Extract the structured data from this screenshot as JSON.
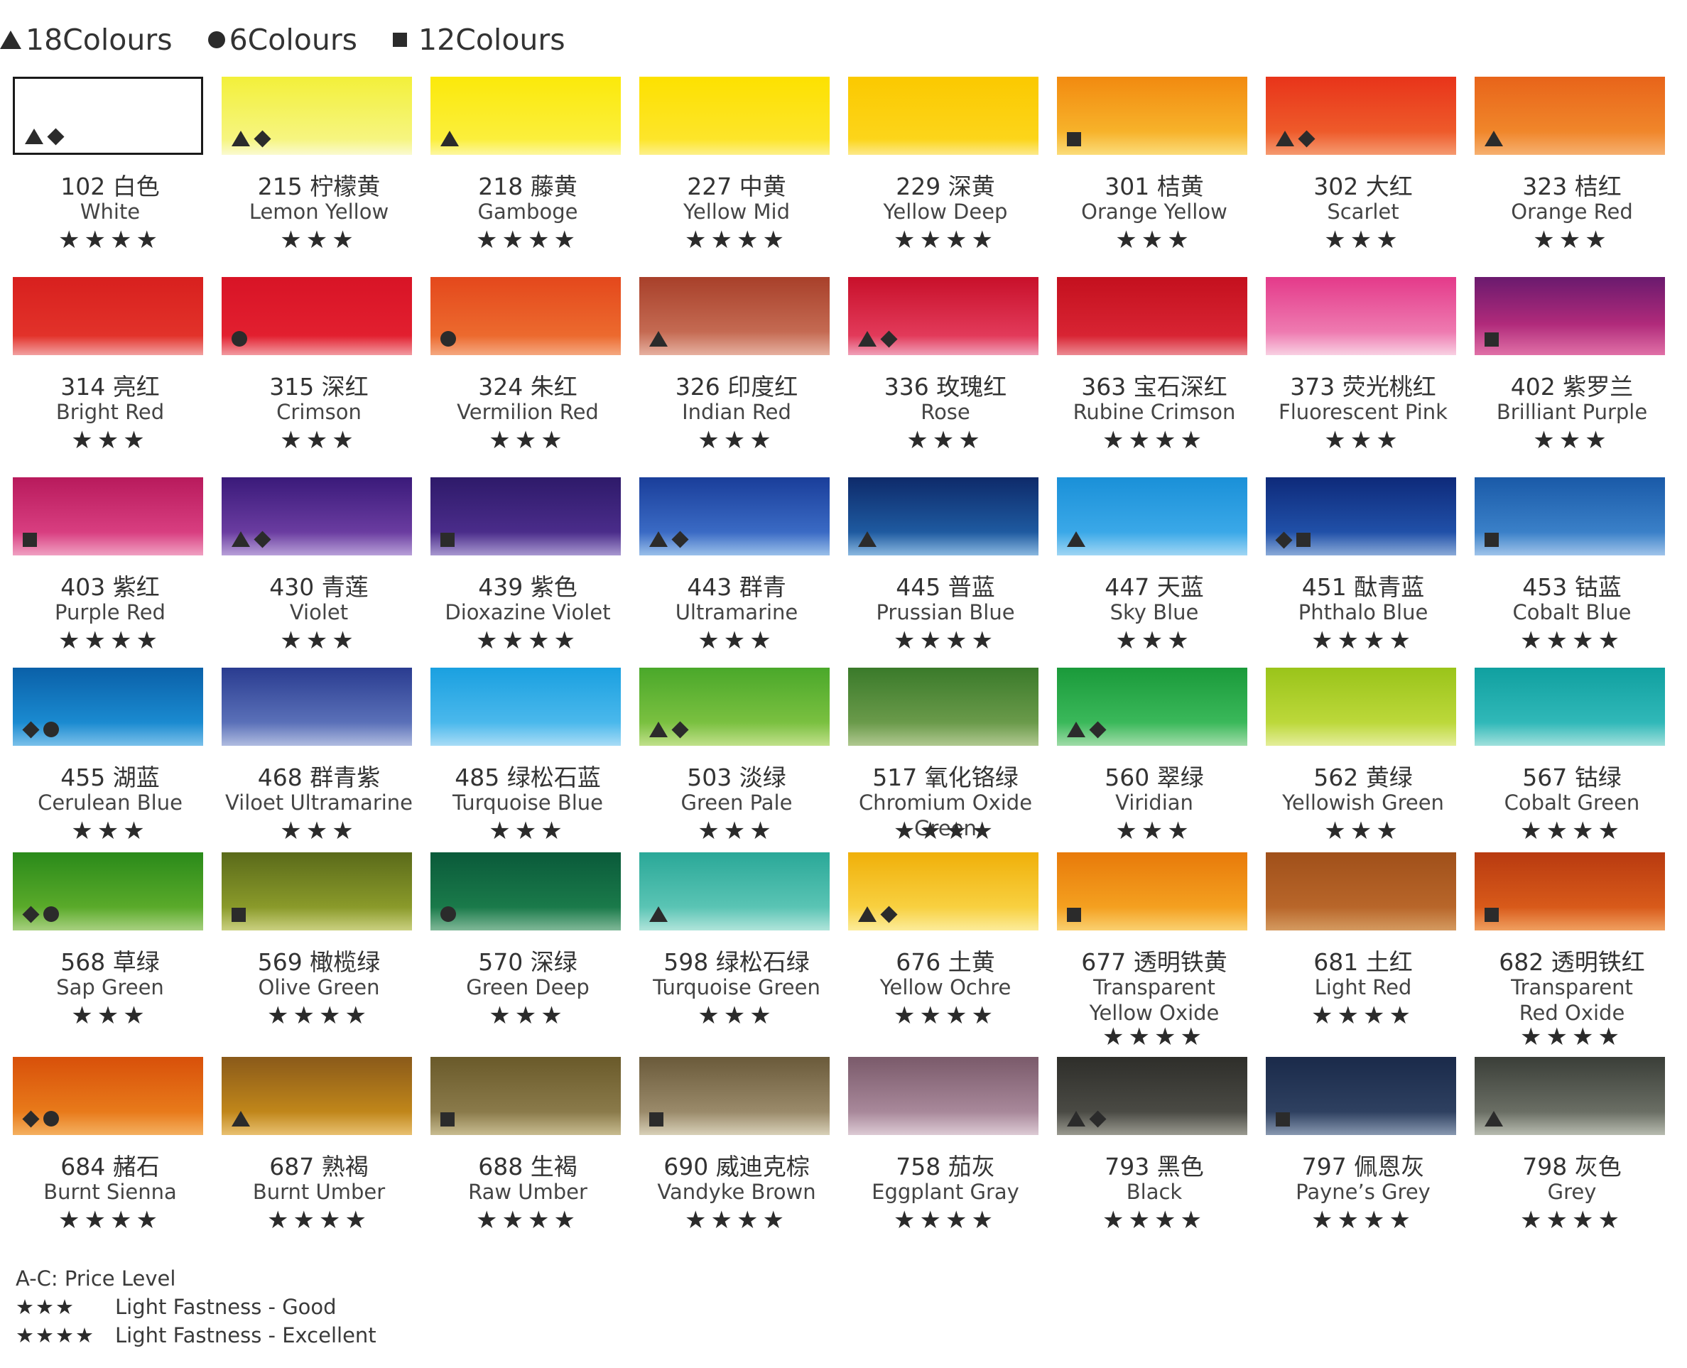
{
  "legend": [
    {
      "icon": "triangle-icon",
      "label": "18Colours"
    },
    {
      "icon": "circle-icon",
      "label": "6Colours"
    },
    {
      "icon": "square-icon",
      "label": "12Colours"
    }
  ],
  "colors": [
    {
      "cn": "102 白色",
      "en": "White",
      "stars": "★★★★",
      "marks": [
        "tri",
        "dia"
      ],
      "bg": "#ffffff",
      "white": true
    },
    {
      "cn": "215 柠檬黄",
      "en": "Lemon Yellow",
      "stars": "★★★",
      "marks": [
        "tri",
        "dia"
      ],
      "bg": "linear-gradient(180deg,#f3f03a,#f6f580 80%,#fafad0)"
    },
    {
      "cn": "218 藤黄",
      "en": "Gamboge",
      "stars": "★★★★",
      "marks": [
        "tri"
      ],
      "bg": "linear-gradient(180deg,#fbe90a,#fbef3c 80%,#fdf7a0)"
    },
    {
      "cn": "227 中黄",
      "en": "Yellow Mid",
      "stars": "★★★★",
      "marks": [],
      "bg": "linear-gradient(180deg,#fde100,#fde52a 80%,#fdf08a)"
    },
    {
      "cn": "229 深黄",
      "en": "Yellow Deep",
      "stars": "★★★★",
      "marks": [],
      "bg": "linear-gradient(180deg,#fbc900,#fcd51a 80%,#fde98a)"
    },
    {
      "cn": "301 桔黄",
      "en": "Orange Yellow",
      "stars": "★★★",
      "marks": [
        "sq"
      ],
      "bg": "linear-gradient(180deg,#f28a10,#f7b22a 70%,#fbdc7a)"
    },
    {
      "cn": "302 大红",
      "en": "Scarlet",
      "stars": "★★★",
      "marks": [
        "tri",
        "dia"
      ],
      "bg": "linear-gradient(180deg,#e8341a,#ee5a2a 70%,#f59a70)"
    },
    {
      "cn": "323 桔红",
      "en": "Orange Red",
      "stars": "★★★",
      "marks": [
        "tri"
      ],
      "bg": "linear-gradient(180deg,#e8641a,#f0862a 70%,#f6b070)"
    },
    {
      "cn": "314 亮红",
      "en": "Bright Red",
      "stars": "★★★",
      "marks": [],
      "bg": "linear-gradient(180deg,#d8201e,#e2322a 75%,#f2a0a0)"
    },
    {
      "cn": "315 深红",
      "en": "Crimson",
      "stars": "★★★",
      "marks": [
        "dot"
      ],
      "bg": "linear-gradient(180deg,#d81426,#e21f2f 75%,#f29aa0)"
    },
    {
      "cn": "324 朱红",
      "en": "Vermilion Red",
      "stars": "★★★",
      "marks": [
        "dot"
      ],
      "bg": "linear-gradient(180deg,#e4481c,#ec6a2e 75%,#f5a880)"
    },
    {
      "cn": "326 印度红",
      "en": "Indian Red",
      "stars": "★★★",
      "marks": [
        "tri"
      ],
      "bg": "linear-gradient(180deg,#a8402a,#c46a52 70%,#e6b0a0)"
    },
    {
      "cn": "336 玫瑰红",
      "en": "Rose",
      "stars": "★★★",
      "marks": [
        "tri",
        "dia"
      ],
      "bg": "linear-gradient(180deg,#c8102a,#e23a5a 75%,#f0a0b8)"
    },
    {
      "cn": "363 宝石深红",
      "en": "Rubine Crimson",
      "stars": "★★★★",
      "marks": [],
      "bg": "linear-gradient(180deg,#c4101e,#d82433 75%,#ec8a92)"
    },
    {
      "cn": "373 荧光桃红",
      "en": "Fluorescent Pink",
      "stars": "★★★",
      "marks": [],
      "bg": "linear-gradient(180deg,#e43a8a,#ee7ab0 70%,#f8d0e2)"
    },
    {
      "cn": "402 紫罗兰",
      "en": "Brilliant Purple",
      "stars": "★★★",
      "marks": [
        "sq"
      ],
      "bg": "linear-gradient(180deg,#6a1a6e,#b02a7a 60%,#e070a6)"
    },
    {
      "cn": "403 紫红",
      "en": "Purple Red",
      "stars": "★★★★",
      "marks": [
        "sq"
      ],
      "bg": "linear-gradient(180deg,#b81a5c,#d83e80 70%,#f0a0c2)"
    },
    {
      "cn": "430 青莲",
      "en": "Violet",
      "stars": "★★★",
      "marks": [
        "tri",
        "dia"
      ],
      "bg": "linear-gradient(180deg,#3a1a7a,#6a3ca0 70%,#b8a0d8)"
    },
    {
      "cn": "439 紫色",
      "en": "Dioxazine Violet",
      "stars": "★★★★",
      "marks": [
        "sq"
      ],
      "bg": "linear-gradient(180deg,#2e1a6a,#4a2c8a 70%,#a898d0)"
    },
    {
      "cn": "443 群青",
      "en": "Ultramarine",
      "stars": "★★★",
      "marks": [
        "tri",
        "dia"
      ],
      "bg": "linear-gradient(180deg,#1a3e9a,#3a6ac4 70%,#9ac0ea)"
    },
    {
      "cn": "445 普蓝",
      "en": "Prussian Blue",
      "stars": "★★★★",
      "marks": [
        "tri"
      ],
      "bg": "linear-gradient(180deg,#0e2a6a,#1e5aa0 70%,#8ab8e0)"
    },
    {
      "cn": "447 天蓝",
      "en": "Sky Blue",
      "stars": "★★★",
      "marks": [
        "tri"
      ],
      "bg": "linear-gradient(180deg,#1a90d8,#3aa8e8 70%,#a0d6f4)"
    },
    {
      "cn": "451 酞青蓝",
      "en": "Phthalo Blue",
      "stars": "★★★★",
      "marks": [
        "dia",
        "sq"
      ],
      "bg": "linear-gradient(180deg,#0e2a7a,#2050a8 70%,#8aaad8)"
    },
    {
      "cn": "453 钴蓝",
      "en": "Cobalt Blue",
      "stars": "★★★★",
      "marks": [
        "sq"
      ],
      "bg": "linear-gradient(180deg,#1a5aa8,#3a80c8 70%,#a0c4ea)"
    },
    {
      "cn": "455 湖蓝",
      "en": "Cerulean Blue",
      "stars": "★★★",
      "marks": [
        "dia",
        "dot"
      ],
      "bg": "linear-gradient(180deg,#0a60a8,#1a8ad0 70%,#7ac0ea)"
    },
    {
      "cn": "468 群青紫",
      "en": "Viloet Ultramarine",
      "stars": "★★★",
      "marks": [],
      "bg": "linear-gradient(180deg,#2a3c90,#5a70b8 70%,#b0bce0)"
    },
    {
      "cn": "485 绿松石蓝",
      "en": "Turquoise Blue",
      "stars": "★★★",
      "marks": [],
      "bg": "linear-gradient(180deg,#1aa0e0,#4ab8ec 70%,#a8dcf6)"
    },
    {
      "cn": "503 淡绿",
      "en": "Green Pale",
      "stars": "★★★",
      "marks": [
        "tri",
        "dia"
      ],
      "bg": "linear-gradient(180deg,#4aa82a,#7ac040 70%,#c0e08a)"
    },
    {
      "cn": "517 氧化铬绿",
      "en": "Chromium Oxide Green",
      "stars": "★★★★",
      "marks": [],
      "bg": "linear-gradient(180deg,#3a7a2a,#6a9a4a 70%,#b0c890)"
    },
    {
      "cn": "560 翠绿",
      "en": "Viridian",
      "stars": "★★★",
      "marks": [
        "tri",
        "dia"
      ],
      "bg": "linear-gradient(180deg,#1a9a3a,#3ab85a 70%,#a0dca8)"
    },
    {
      "cn": "562 黄绿",
      "en": "Yellowish Green",
      "stars": "★★★",
      "marks": [],
      "bg": "linear-gradient(180deg,#9ac41a,#bcd83a 70%,#e4ee9a)"
    },
    {
      "cn": "567 钴绿",
      "en": "Cobalt Green",
      "stars": "★★★★",
      "marks": [],
      "bg": "linear-gradient(180deg,#10a0a0,#30b8b8 70%,#a0e0dc)"
    },
    {
      "cn": "568 草绿",
      "en": "Sap Green",
      "stars": "★★★",
      "marks": [
        "dia",
        "dot"
      ],
      "bg": "linear-gradient(180deg,#2a8a1a,#5aaa2a 70%,#a8d080)"
    },
    {
      "cn": "569 橄榄绿",
      "en": "Olive Green",
      "stars": "★★★★",
      "marks": [
        "sq"
      ],
      "bg": "linear-gradient(180deg,#5a6a1a,#8a9a2a 70%,#cad080)"
    },
    {
      "cn": "570 深绿",
      "en": "Green Deep",
      "stars": "★★★",
      "marks": [
        "dot"
      ],
      "bg": "linear-gradient(180deg,#0a5a3a,#1a7a4a 70%,#80b898)"
    },
    {
      "cn": "598 绿松石绿",
      "en": "Turquoise Green",
      "stars": "★★★",
      "marks": [
        "tri"
      ],
      "bg": "linear-gradient(180deg,#2aa898,#5ac4b4 70%,#b0e4da)"
    },
    {
      "cn": "676 土黄",
      "en": "Yellow Ochre",
      "stars": "★★★★",
      "marks": [
        "tri",
        "dia"
      ],
      "bg": "linear-gradient(180deg,#f0b00a,#f8d040 70%,#fcec9a)"
    },
    {
      "cn": "677 透明铁黄",
      "en": "Transparent\nYellow Oxide",
      "stars": "★★★★",
      "marks": [
        "sq"
      ],
      "bg": "linear-gradient(180deg,#e87a0a,#f4a020 70%,#fad070)"
    },
    {
      "cn": "681 土红",
      "en": "Light Red",
      "stars": "★★★★",
      "marks": [],
      "bg": "linear-gradient(180deg,#a0501a,#b8662a 70%,#d49a60)"
    },
    {
      "cn": "682 透明铁红",
      "en": "Transparent\nRed Oxide",
      "stars": "★★★★",
      "marks": [
        "sq"
      ],
      "bg": "linear-gradient(180deg,#b83a10,#d85a1a 70%,#f0a060)"
    },
    {
      "cn": "684 赭石",
      "en": "Burnt Sienna",
      "stars": "★★★★",
      "marks": [
        "dia",
        "dot"
      ],
      "bg": "linear-gradient(180deg,#d8500a,#e87a1a 70%,#f4b060)"
    },
    {
      "cn": "687 熟褐",
      "en": "Burnt Umber",
      "stars": "★★★★",
      "marks": [
        "tri"
      ],
      "bg": "linear-gradient(180deg,#8a5a1a,#c0861a 70%,#e8c070)"
    },
    {
      "cn": "688 生褐",
      "en": "Raw Umber",
      "stars": "★★★★",
      "marks": [
        "sq"
      ],
      "bg": "linear-gradient(180deg,#6a5a2a,#8a7a4a 70%,#c8bc90)"
    },
    {
      "cn": "690 威迪克棕",
      "en": "Vandyke Brown",
      "stars": "★★★★",
      "marks": [
        "sq"
      ],
      "bg": "linear-gradient(180deg,#6a5a3a,#9a8a6a 70%,#d8d0b8)"
    },
    {
      "cn": "758 茄灰",
      "en": "Eggplant Gray",
      "stars": "★★★★",
      "marks": [],
      "bg": "linear-gradient(180deg,#7a5a6a,#a8889a 70%,#dccad4)"
    },
    {
      "cn": "793 黑色",
      "en": "Black",
      "stars": "★★★★",
      "marks": [
        "tri",
        "dia"
      ],
      "bg": "linear-gradient(180deg,#2e2e2a,#4a4a44 70%,#9a9a90)"
    },
    {
      "cn": "797 佩恩灰",
      "en": "Payne’s Grey",
      "stars": "★★★★",
      "marks": [
        "sq"
      ],
      "bg": "linear-gradient(180deg,#1a2a4a,#2e4060 70%,#8898b0)"
    },
    {
      "cn": "798 灰色",
      "en": "Grey",
      "stars": "★★★★",
      "marks": [
        "tri"
      ],
      "bg": "linear-gradient(180deg,#3a3e38,#6a6e64 70%,#b8bcb0)"
    }
  ],
  "footer": {
    "price": "A-C:  Price Level",
    "r1_key": "★★★",
    "r1_label": "Light Fastness - Good",
    "r2_key": "★★★★",
    "r2_label": "Light Fastness - Excellent"
  }
}
